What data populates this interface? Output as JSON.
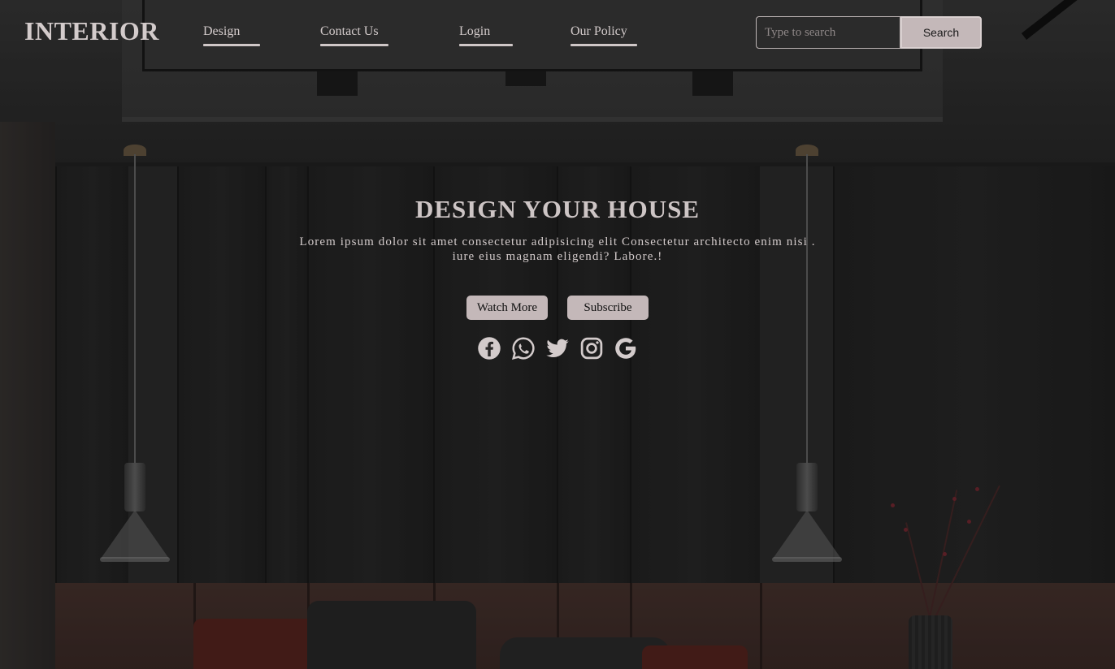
{
  "brand": {
    "logo": "INTERIOR"
  },
  "nav": {
    "items": [
      {
        "label": "Design"
      },
      {
        "label": "Contact Us"
      },
      {
        "label": "Login"
      },
      {
        "label": "Our Policy"
      }
    ]
  },
  "search": {
    "placeholder": "Type to search",
    "value": "",
    "button_label": "Search"
  },
  "hero": {
    "title": "DESIGN YOUR HOUSE",
    "text_line1": "Lorem ipsum dolor sit amet consectetur adipisicing elit Consectetur architecto enim nisi .",
    "text_line2": "iure eius magnam eligendi? Labore.!",
    "buttons": {
      "watch_more": "Watch More",
      "subscribe": "Subscribe"
    }
  },
  "social": {
    "icons": [
      "facebook-icon",
      "whatsapp-icon",
      "twitter-icon",
      "instagram-icon",
      "google-icon"
    ]
  },
  "colors": {
    "text": "#d3cbcb",
    "button_bg": "#c4b8b9",
    "underline": "#cfc7c7"
  }
}
